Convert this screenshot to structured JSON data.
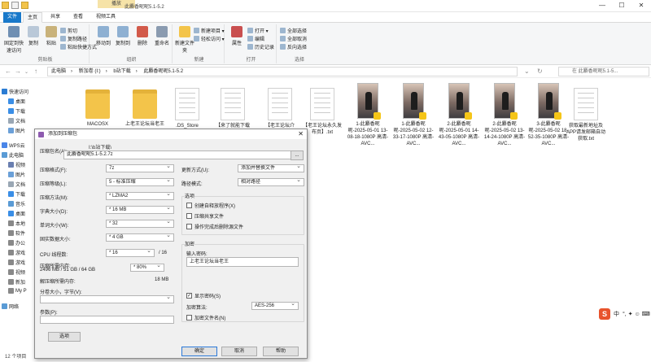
{
  "window": {
    "title": "此麝香昵昵5.1-5.2",
    "context_tab": "播放",
    "controls": [
      "—",
      "☐",
      "✕"
    ]
  },
  "ribbon_tabs": [
    "文件",
    "主页",
    "共享",
    "查看",
    "视频工具"
  ],
  "ribbon": {
    "pin_label": "固定到快速访问",
    "copy_label": "复制",
    "paste_label": "粘贴",
    "clip_small": [
      "剪切",
      "复制路径",
      "粘贴快捷方式"
    ],
    "clip_group": "剪贴板",
    "move_label": "移动到",
    "copyto_label": "复制到",
    "delete_label": "删除",
    "rename_label": "重命名",
    "org_group": "组织",
    "newfolder_label": "新建文件夹",
    "new_small": [
      "新建项目 ▾",
      "轻松访问 ▾"
    ],
    "new_group": "新建",
    "props_label": "属性",
    "open_small": [
      "打开 ▾",
      "编辑",
      "历史记录"
    ],
    "open_group": "打开",
    "select_small": [
      "全部选择",
      "全部取消",
      "反向选择"
    ],
    "select_group": "选择"
  },
  "address": {
    "crumbs": [
      "此电脑",
      "新加卷 (I:)",
      "b站下载",
      "此麝香昵昵5.1-5.2"
    ],
    "search_placeholder": "在 此麝香昵昵5.1-5..."
  },
  "nav": [
    {
      "label": "快速访问",
      "color": "#2b7cd3"
    },
    {
      "label": "桌面",
      "color": "#3a8ee6"
    },
    {
      "label": "下载",
      "color": "#3a8ee6"
    },
    {
      "label": "文档",
      "color": "#9aa7b4"
    },
    {
      "label": "图片",
      "color": "#6ba0d8"
    },
    {
      "label": "WPS云",
      "color": "#4a86e8"
    },
    {
      "label": "此电脑",
      "color": "#5a9bd5"
    },
    {
      "label": "视频",
      "color": "#6a7fb0"
    },
    {
      "label": "图片",
      "color": "#6ba0d8"
    },
    {
      "label": "文档",
      "color": "#9aa7b4"
    },
    {
      "label": "下载",
      "color": "#3a8ee6"
    },
    {
      "label": "音乐",
      "color": "#5a9bd5"
    },
    {
      "label": "桌面",
      "color": "#3a8ee6"
    },
    {
      "label": "本地",
      "color": "#888888"
    },
    {
      "label": "软件",
      "color": "#888888"
    },
    {
      "label": "办公",
      "color": "#888888"
    },
    {
      "label": "游戏",
      "color": "#888888"
    },
    {
      "label": "游戏",
      "color": "#888888"
    },
    {
      "label": "视频",
      "color": "#888888"
    },
    {
      "label": "新加",
      "color": "#888888"
    },
    {
      "label": "My P",
      "color": "#888888"
    },
    {
      "label": "网络",
      "color": "#5a9bd5"
    }
  ],
  "files": [
    {
      "name": "MACOSX",
      "kind": "folder"
    },
    {
      "name": "上老王论坛当老王",
      "kind": "folder"
    },
    {
      "name": ".DS_Store",
      "kind": "doc"
    },
    {
      "name": "【来了就能下载",
      "kind": "doc"
    },
    {
      "name": "【老王论坛介",
      "kind": "doc"
    },
    {
      "name": "【老王论坛永久发布页】.txt",
      "kind": "doc"
    },
    {
      "name": "1-此麝香昵昵-2025-05-01 13-08-18-1080P 高清-AVC...",
      "kind": "photo"
    },
    {
      "name": "1-此麝香昵昵-2025-05-02 12-33-17-1080P 高清-AVC...",
      "kind": "photo"
    },
    {
      "name": "2-此麝香昵昵-2025-05-01 14-43-05-1080P 高清-AVC...",
      "kind": "photo"
    },
    {
      "name": "2-此麝香昵昵-2025-05-02 13-14-24-1080P 高清-AVC...",
      "kind": "photo"
    },
    {
      "name": "3-此麝香昵昵-2025-05-02 18-52-35-1080P 高清-AVC...",
      "kind": "photo"
    },
    {
      "name": "获取最新地址及APP请发邮箱自动获取.txt",
      "kind": "doc"
    }
  ],
  "status": {
    "count": "12 个项目"
  },
  "dialog": {
    "title": "添加到压缩包",
    "close": "✕",
    "archive_name_label": "压缩包名(A):",
    "archive_path": "I:\\b站下载\\",
    "archive_name": "此麝香昵昵5.1-5.2.7z",
    "browse": "...",
    "format_label": "压缩格式(F):",
    "format_value": "7z",
    "level_label": "压缩等级(L):",
    "level_value": "5 - 标准压缩",
    "method_label": "压缩方法(M):",
    "method_value": "* LZMA2",
    "dict_label": "字典大小(D):",
    "dict_value": "* 16 MB",
    "word_label": "单词大小(W):",
    "word_value": "* 32",
    "solid_label": "固实数据大小:",
    "solid_value": "* 4 GB",
    "cpu_label": "CPU 线程数:",
    "cpu_value": "* 16",
    "cpu_max": "/ 16",
    "mem_label": "压缩所需内存:",
    "mem_detail": "2496 MB / 51 GB / 64 GB",
    "mem_value": "* 80%",
    "demem_label": "解压缩所需内存:",
    "demem_value": "18 MB",
    "split_label": "分卷大小，字节(V):",
    "params_label": "参数(P):",
    "options_button": "选项",
    "update_label": "更新方式(U):",
    "update_value": "添加并替换文件",
    "pathmode_label": "路径模式:",
    "pathmode_value": "相对路径",
    "opts_group": "选项",
    "opt_sfx": "创建自释放程序(X)",
    "opt_shared": "压缩共享文件",
    "opt_delete": "操作完成后删除源文件",
    "enc_group": "加密",
    "pwd_label": "输入密码:",
    "pwd_value": "上老王论坛当老王",
    "showpwd_label": "显示密码(S)",
    "encmethod_label": "加密算法:",
    "encmethod_value": "AES-256",
    "encnames_label": "加密文件名(N)",
    "ok": "确定",
    "cancel": "取消",
    "help": "帮助"
  },
  "tray": {
    "ime": "中",
    "glyphs": "°, ✦ ☺ ⌨"
  },
  "colors": {
    "accent": "#1979ca",
    "ctx_tab": "#f6e3a8",
    "folder": "#f3c44a"
  }
}
